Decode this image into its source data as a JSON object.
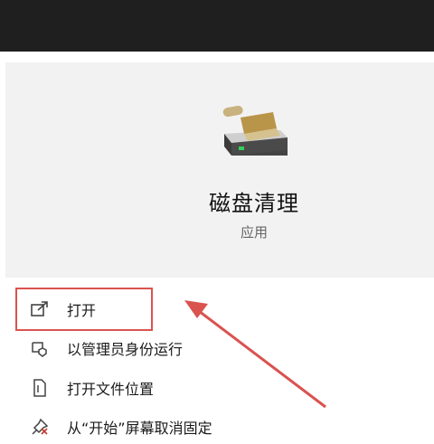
{
  "app": {
    "title": "磁盘清理",
    "subtitle": "应用",
    "icon": "disk-cleanup-icon"
  },
  "menu": [
    {
      "label": "打开",
      "icon": "open-icon"
    },
    {
      "label": "以管理员身份运行",
      "icon": "admin-shield-icon"
    },
    {
      "label": "打开文件位置",
      "icon": "file-location-icon"
    },
    {
      "label": "从“开始”屏幕取消固定",
      "icon": "unpin-icon"
    }
  ],
  "colors": {
    "accent": "#d9534f",
    "topbar": "#1f1f1f",
    "hero": "#f2f2f2"
  }
}
